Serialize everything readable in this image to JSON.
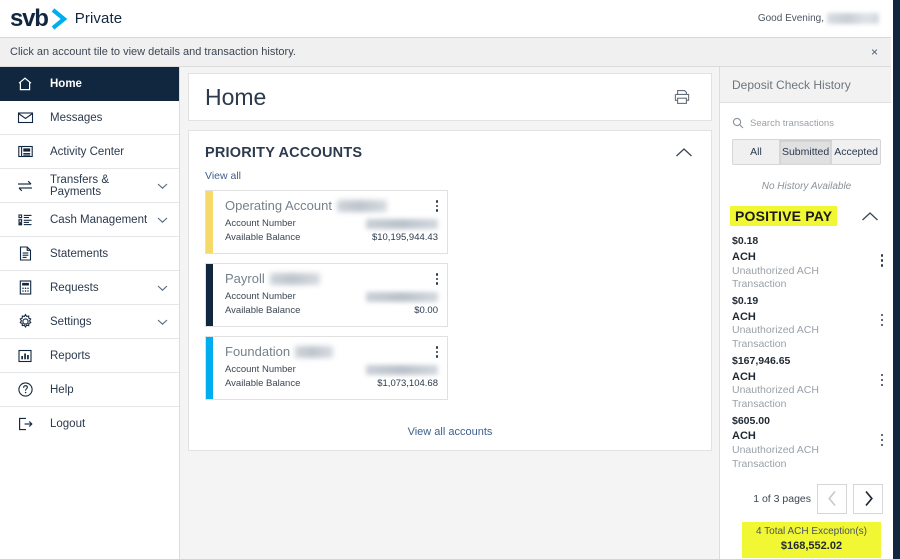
{
  "header": {
    "logo_svb": "svb",
    "logo_chevron_icon": "chevron-right-logo-icon",
    "logo_private": "Private",
    "greeting": "Good Evening,",
    "greeting_name_redacted": "",
    "brand_navy": "#11273f",
    "brand_cyan": "#00aeef"
  },
  "notification": {
    "text": "Click an account tile to view details and transaction history.",
    "close_label": "×",
    "close_icon": "close-icon"
  },
  "sidebar": {
    "items": [
      {
        "label": "Home",
        "icon": "home-icon",
        "active": true,
        "caret": false
      },
      {
        "label": "Messages",
        "icon": "envelope-icon",
        "active": false,
        "caret": false
      },
      {
        "label": "Activity Center",
        "icon": "activity-center-icon",
        "active": false,
        "caret": false
      },
      {
        "label": "Transfers & Payments",
        "icon": "transfer-arrows-icon",
        "active": false,
        "caret": true
      },
      {
        "label": "Cash Management",
        "icon": "list-icon",
        "active": false,
        "caret": true
      },
      {
        "label": "Statements",
        "icon": "document-icon",
        "active": false,
        "caret": false
      },
      {
        "label": "Requests",
        "icon": "calculator-icon",
        "active": false,
        "caret": true
      },
      {
        "label": "Settings",
        "icon": "gear-icon",
        "active": false,
        "caret": true
      },
      {
        "label": "Reports",
        "icon": "bar-chart-icon",
        "active": false,
        "caret": false
      },
      {
        "label": "Help",
        "icon": "question-circle-icon",
        "active": false,
        "caret": false
      },
      {
        "label": "Logout",
        "icon": "logout-icon",
        "active": false,
        "caret": false
      }
    ]
  },
  "main": {
    "page_title": "Home",
    "print_icon": "printer-icon",
    "section_title": "PRIORITY ACCOUNTS",
    "collapse_icon": "chevron-up-icon",
    "view_all_label": "View all",
    "view_all_accounts_label": "View all accounts",
    "tile_labels": {
      "account_number": "Account Number",
      "available_balance": "Available Balance"
    },
    "accounts": [
      {
        "name": "Operating Account",
        "masked_suffix_redacted": true,
        "account_number_redacted": true,
        "available_balance": "$10,195,944.43",
        "accent_color": "#f5d96b",
        "menu_icon": "kebab-menu-icon"
      },
      {
        "name": "Payroll",
        "masked_suffix_redacted": true,
        "account_number_redacted": true,
        "available_balance": "$0.00",
        "accent_color": "#11273f",
        "menu_icon": "kebab-menu-icon"
      },
      {
        "name": "Foundation",
        "masked_suffix_redacted": true,
        "account_number_redacted": true,
        "available_balance": "$1,073,104.68",
        "accent_color": "#00aeef",
        "menu_icon": "kebab-menu-icon"
      }
    ]
  },
  "right_panel": {
    "title": "Deposit Check History",
    "search": {
      "icon": "search-icon",
      "placeholder": "Search transactions",
      "value": ""
    },
    "filters": [
      {
        "label": "All",
        "selected": false
      },
      {
        "label": "Submitted",
        "selected": true
      },
      {
        "label": "Accepted",
        "selected": false
      }
    ],
    "empty_state": "No History Available",
    "positive_pay": {
      "title": "POSITIVE PAY",
      "highlight_color": "#f2f733",
      "collapse_icon": "chevron-up-icon",
      "items": [
        {
          "amount": "$0.18",
          "type": "ACH",
          "description": "Unauthorized ACH Transaction",
          "menu_icon": "kebab-menu-icon"
        },
        {
          "amount": "$0.19",
          "type": "ACH",
          "description": "Unauthorized ACH Transaction",
          "menu_icon": "kebab-menu-icon"
        },
        {
          "amount": "$167,946.65",
          "type": "ACH",
          "description": "Unauthorized ACH Transaction",
          "menu_icon": "kebab-menu-icon"
        },
        {
          "amount": "$605.00",
          "type": "ACH",
          "description": "Unauthorized ACH Transaction",
          "menu_icon": "kebab-menu-icon"
        }
      ],
      "pager": {
        "label": "1 of 3 pages",
        "prev_icon": "chevron-left-icon",
        "next_icon": "chevron-right-icon",
        "prev_enabled": false,
        "next_enabled": true
      },
      "total_label": "4 Total ACH Exception(s)",
      "total_amount": "$168,552.02"
    }
  }
}
